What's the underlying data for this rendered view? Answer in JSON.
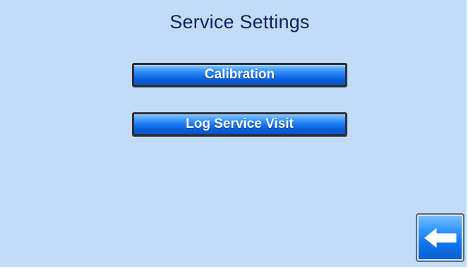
{
  "screen": {
    "title": "Service Settings"
  },
  "menu": {
    "calibration_label": "Calibration",
    "log_service_visit_label": "Log Service Visit"
  },
  "navigation": {
    "back_icon": "arrow-left-icon"
  },
  "colors": {
    "background": "#c2dcf7",
    "title_text": "#14205e",
    "button_blue": "#1e7cf4",
    "button_text": "#ffffff"
  }
}
